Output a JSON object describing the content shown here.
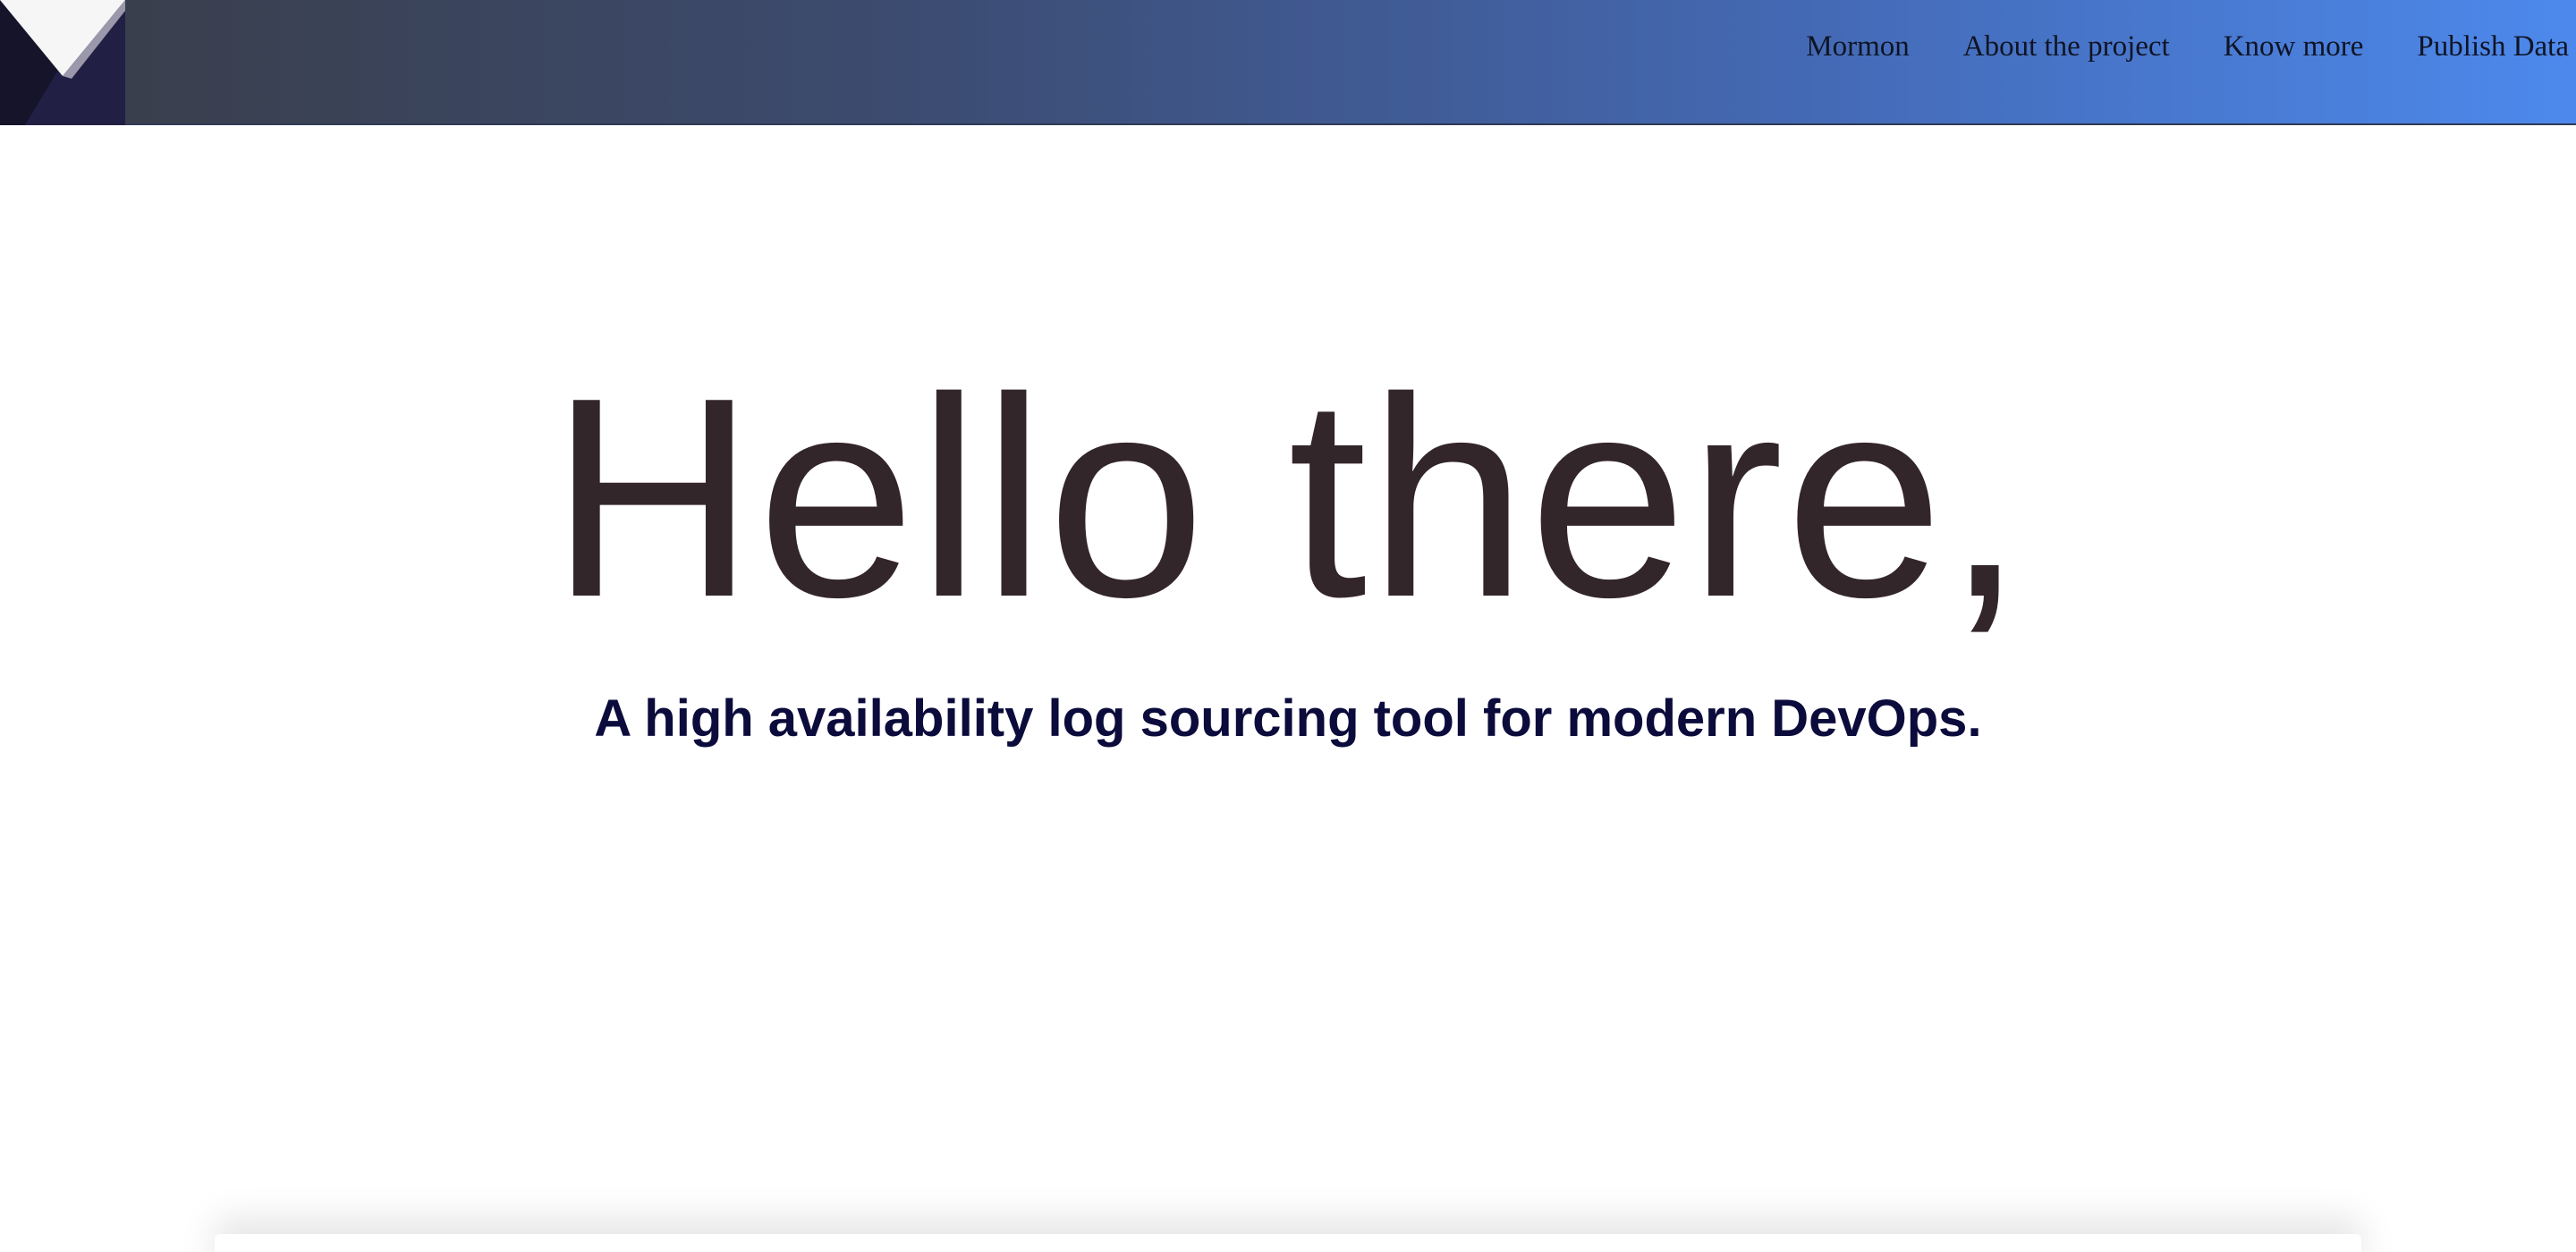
{
  "header": {
    "logo_icon": "mormon-logo-icon",
    "gradient": [
      "#393d47",
      "#3c4b70",
      "#4469b4",
      "#4d89ec"
    ],
    "nav": [
      {
        "label": "Mormon"
      },
      {
        "label": "About the project"
      },
      {
        "label": "Know more"
      },
      {
        "label": "Publish Data"
      }
    ]
  },
  "hero": {
    "title": "Hello there,",
    "subtitle": "A high availability log sourcing tool for modern DevOps.",
    "title_color": "#33262b",
    "subtitle_color": "#0b0b3c"
  }
}
